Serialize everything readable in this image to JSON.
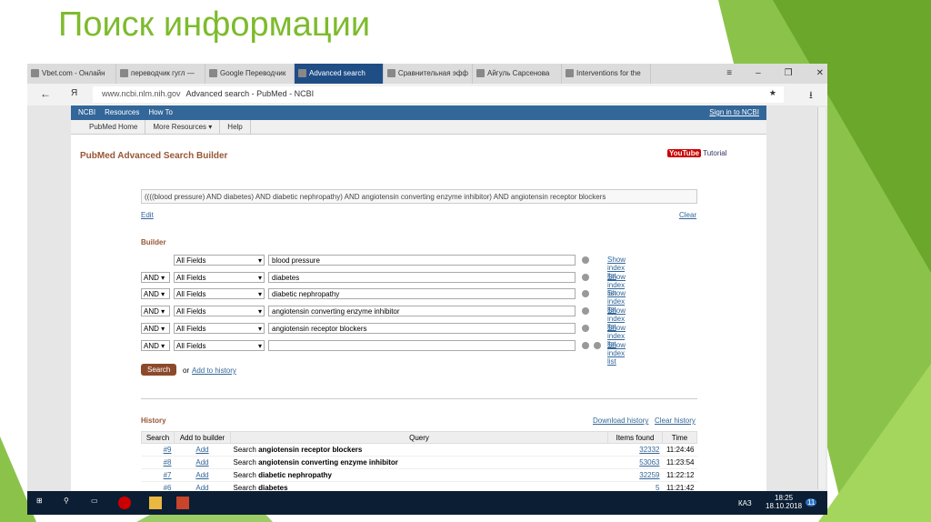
{
  "slide": {
    "title": "Поиск информации"
  },
  "browser": {
    "tabs": [
      "Vbet.com - Онлайн",
      "переводчик гугл —",
      "Google Переводчик",
      "Advanced search",
      "Сравнительная эфф",
      "Айгуль Сарсенова",
      "Interventions for the"
    ],
    "active_tab": 3,
    "url_host": "www.ncbi.nlm.nih.gov",
    "page_title": "Advanced search - PubMed - NCBI"
  },
  "ncbi": {
    "logo": "NCBI",
    "resources": "Resources",
    "howto": "How To",
    "signin": "Sign in to NCBI",
    "subnav": [
      "PubMed Home",
      "More Resources ▾",
      "Help"
    ]
  },
  "builder": {
    "heading": "PubMed Advanced Search Builder",
    "tutorial": "Tutorial",
    "youtube": "YouTube",
    "query": "((((blood pressure) AND diabetes) AND diabetic nephropathy) AND angiotensin converting enzyme inhibitor) AND angiotensin receptor blockers",
    "edit": "Edit",
    "clear": "Clear",
    "label": "Builder",
    "rows": [
      {
        "op": "",
        "field": "All Fields",
        "term": "blood pressure"
      },
      {
        "op": "AND",
        "field": "All Fields",
        "term": "diabetes"
      },
      {
        "op": "AND",
        "field": "All Fields",
        "term": "diabetic nephropathy"
      },
      {
        "op": "AND",
        "field": "All Fields",
        "term": "angiotensin converting enzyme inhibitor"
      },
      {
        "op": "AND",
        "field": "All Fields",
        "term": "angiotensin receptor blockers"
      },
      {
        "op": "AND",
        "field": "All Fields",
        "term": ""
      }
    ],
    "show_index": "Show index list",
    "search": "Search",
    "or": "or",
    "add_history": "Add to history"
  },
  "history": {
    "label": "History",
    "download": "Download history",
    "clear": "Clear history",
    "columns": [
      "Search",
      "Add to builder",
      "Query",
      "Items found",
      "Time"
    ],
    "rows": [
      {
        "id": "#9",
        "add": "Add",
        "prefix": "Search",
        "query": "angiotensin receptor blockers",
        "items": "32332",
        "time": "11:24:46"
      },
      {
        "id": "#8",
        "add": "Add",
        "prefix": "Search",
        "query": "angiotensin converting enzyme inhibitor",
        "items": "53063",
        "time": "11:23:54"
      },
      {
        "id": "#7",
        "add": "Add",
        "prefix": "Search",
        "query": "diabetic nephropathy",
        "items": "32259",
        "time": "11:22:12"
      },
      {
        "id": "#6",
        "add": "Add",
        "prefix": "Search",
        "query": "diabetes",
        "items": "5",
        "time": "11:21:42"
      }
    ]
  },
  "taskbar": {
    "lang": "КАЗ",
    "time": "18:25",
    "date": "18.10.2018",
    "notifications": "11"
  }
}
